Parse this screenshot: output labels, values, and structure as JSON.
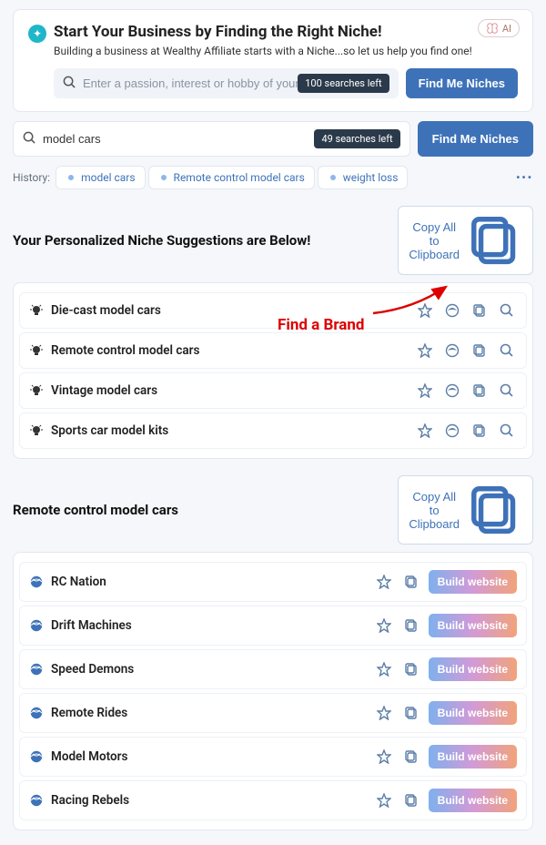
{
  "top": {
    "title": "Start Your Business by Finding the Right Niche!",
    "subtitle": "Building a business at Wealthy Affiliate starts with a Niche...so let us help you find one!",
    "ai_label": "AI",
    "search_placeholder": "Enter a passion, interest or hobby of yours...",
    "searches_left": "100 searches left",
    "button": "Find Me Niches"
  },
  "main_search": {
    "value": "model cars",
    "searches_left": "49 searches left",
    "button": "Find Me Niches"
  },
  "history": {
    "label": "History:",
    "items": [
      "model cars",
      "Remote control model cars",
      "weight loss"
    ]
  },
  "suggestions": {
    "heading": "Your Personalized Niche Suggestions are Below!",
    "copy_all": "Copy All to Clipboard",
    "items": [
      "Die-cast model cars",
      "Remote control model cars",
      "Vintage model cars",
      "Sports car model kits"
    ]
  },
  "brands": {
    "heading": "Remote control model cars",
    "copy_all": "Copy All to Clipboard",
    "build_label": "Build website",
    "items": [
      "RC Nation",
      "Drift Machines",
      "Speed Demons",
      "Remote Rides",
      "Model Motors",
      "Racing Rebels"
    ]
  },
  "annotation": "Find a Brand"
}
